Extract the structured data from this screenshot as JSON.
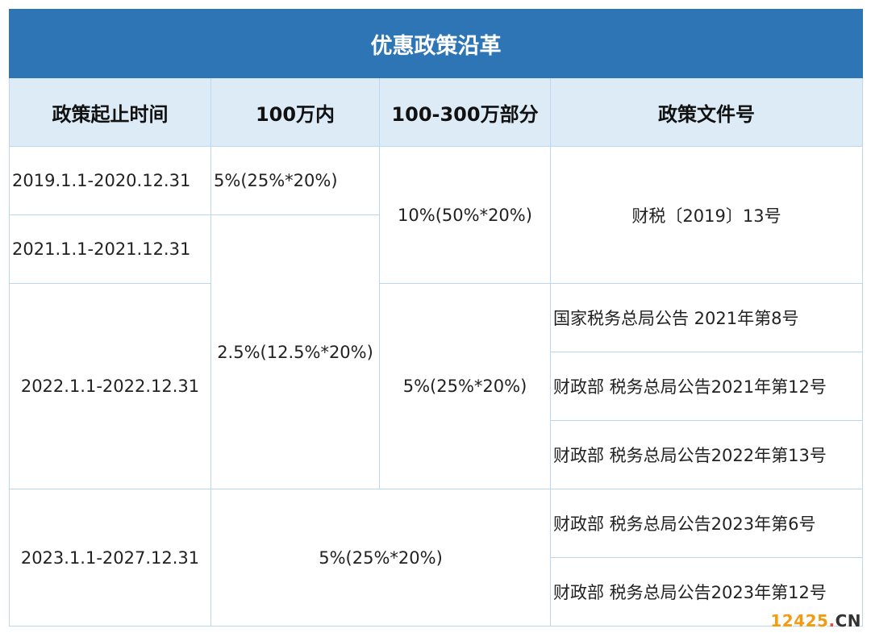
{
  "title": "优惠政策沿革",
  "headers": {
    "period": "政策起止时间",
    "within_1m": "100万内",
    "range_1m_3m": "100-300万部分",
    "document": "政策文件号"
  },
  "rows": {
    "period_2019": "2019.1.1-2020.12.31",
    "period_2021": "2021.1.1-2021.12.31",
    "period_2022": "2022.1.1-2022.12.31",
    "period_2023": "2023.1.1-2027.12.31",
    "within_1m_2019": "5%(25%*20%)",
    "within_1m_2021_2022": "2.5%(12.5%*20%)",
    "range_2019_2021": "10%(50%*20%)",
    "range_2022": "5%(25%*20%)",
    "combined_2023": "5%(25%*20%)",
    "doc_2019_2021": "财税〔2019〕13号",
    "doc_2022_a": "国家税务总局公告 2021年第8号",
    "doc_2022_b": "财政部 税务总局公告2021年第12号",
    "doc_2022_c": "财政部 税务总局公告2022年第13号",
    "doc_2023_a": "财政部 税务总局公告2023年第6号",
    "doc_2023_b": "财政部 税务总局公告2023年第12号"
  },
  "watermark": {
    "number": "12425",
    "dot": ".",
    "suffix": "CN"
  },
  "colors": {
    "title_bg": "#2e75b6",
    "header_bg": "#ddebf7",
    "border": "#bdd7ee"
  }
}
